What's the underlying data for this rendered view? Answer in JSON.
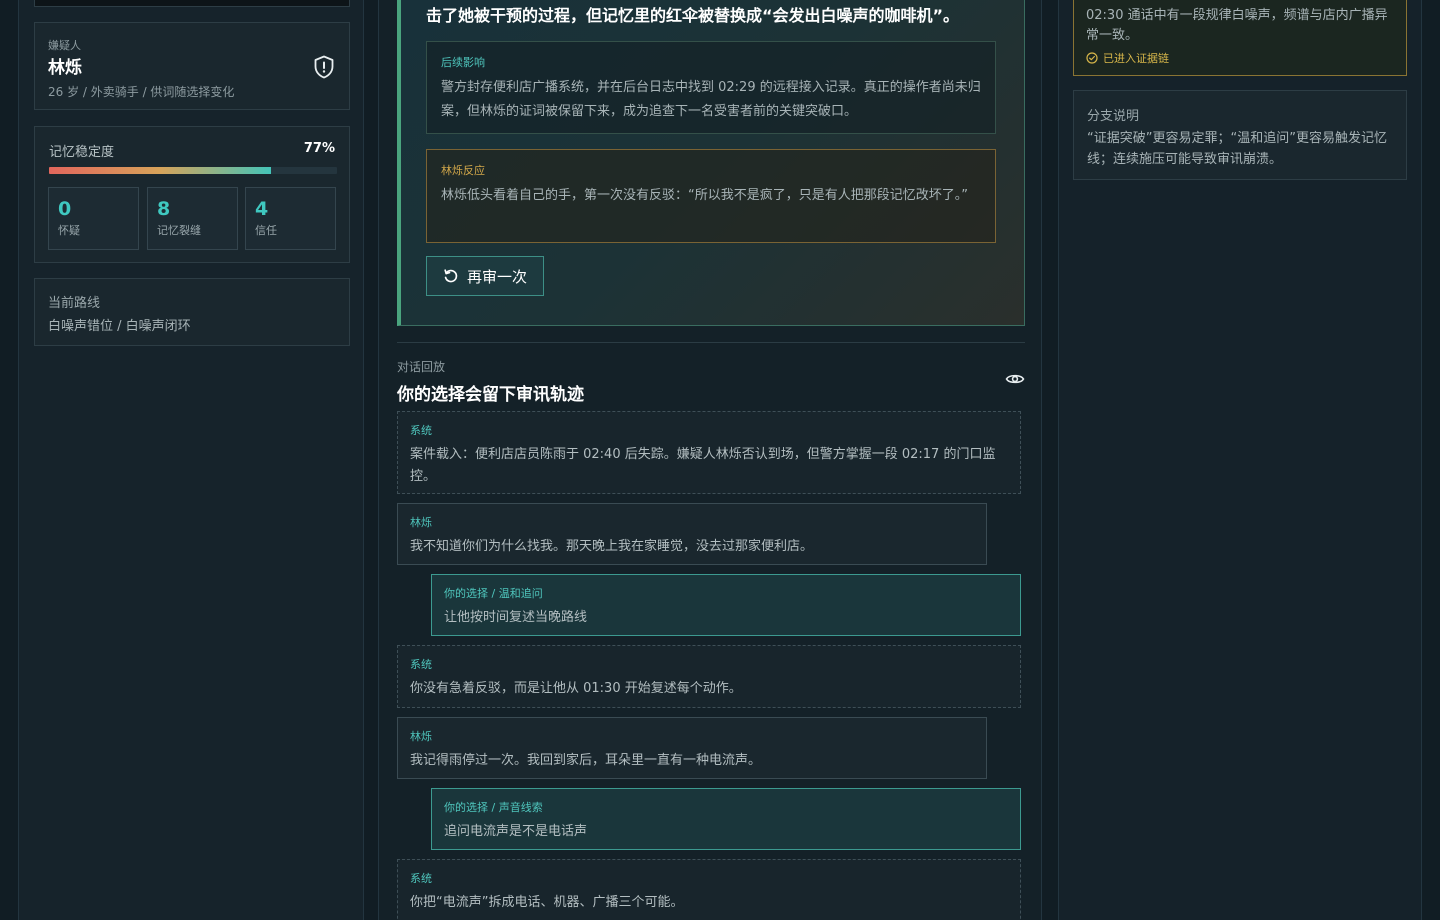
{
  "suspect": {
    "kicker": "嫌疑人",
    "name": "林烁",
    "meta": "26 岁 / 外卖骑手 / 供词随选择变化"
  },
  "memory": {
    "label": "记忆稳定度",
    "percent_text": "77%",
    "stability": 0.77,
    "stats": [
      {
        "value": "0",
        "label": "怀疑"
      },
      {
        "value": "8",
        "label": "记忆裂缝"
      },
      {
        "value": "4",
        "label": "信任"
      }
    ]
  },
  "route": {
    "label": "当前路线",
    "value": "白噪声错位 / 白噪声闭环"
  },
  "verdict": {
    "title": "击了她被干预的过程，但记忆里的红伞被替换成“会发出白噪声的咖啡机”。",
    "aftermath": {
      "heading": "后续影响",
      "text": "警方封存便利店广播系统，并在后台日志中找到 02:29 的远程接入记录。真正的操作者尚未归案，但林烁的证词被保留下来，成为追查下一名受害者前的关键突破口。"
    },
    "reaction": {
      "heading": "林烁反应",
      "text": "林烁低头看着自己的手，第一次没有反驳：“所以我不是疯了，只是有人把那段记忆改坏了。”"
    },
    "retry_label": "再审一次"
  },
  "replay": {
    "kicker": "对话回放",
    "title": "你的选择会留下审讯轨迹",
    "messages": [
      {
        "speaker": "系统",
        "text": "案件载入：便利店店员陈雨于 02:40 后失踪。嫌疑人林烁否认到场，但警方掌握一段 02:17 的门口监控。"
      },
      {
        "speaker": "林烁",
        "text": "我不知道你们为什么找我。那天晚上我在家睡觉，没去过那家便利店。"
      },
      {
        "speaker": "你的选择 / 温和追问",
        "text": "让他按时间复述当晚路线"
      },
      {
        "speaker": "系统",
        "text": "你没有急着反驳，而是让他从 01:30 开始复述每个动作。"
      },
      {
        "speaker": "林烁",
        "text": "我记得雨停过一次。我回到家后，耳朵里一直有一种电流声。"
      },
      {
        "speaker": "你的选择 / 声音线索",
        "text": "追问电流声是不是电话声"
      },
      {
        "speaker": "系统",
        "text": "你把“电流声”拆成电话、机器、广播三个可能。"
      }
    ]
  },
  "evidence": {
    "text": "02:30 通话中有一段规律白噪声，频谱与店内广播异常一致。",
    "tag": "已进入证据链"
  },
  "branch": {
    "heading": "分支说明",
    "text": "“证据突破”更容易定罪；“温和追问”更容易触发记忆线；连续施压可能导致审讯崩溃。"
  },
  "colors": {
    "accent": "#3fc8c0",
    "verdict_border": "#4aa47e",
    "evidence_gold": "#d7b64a",
    "aftermath_heading": "#4fc6bd",
    "reaction_heading": "#d3a84a"
  }
}
